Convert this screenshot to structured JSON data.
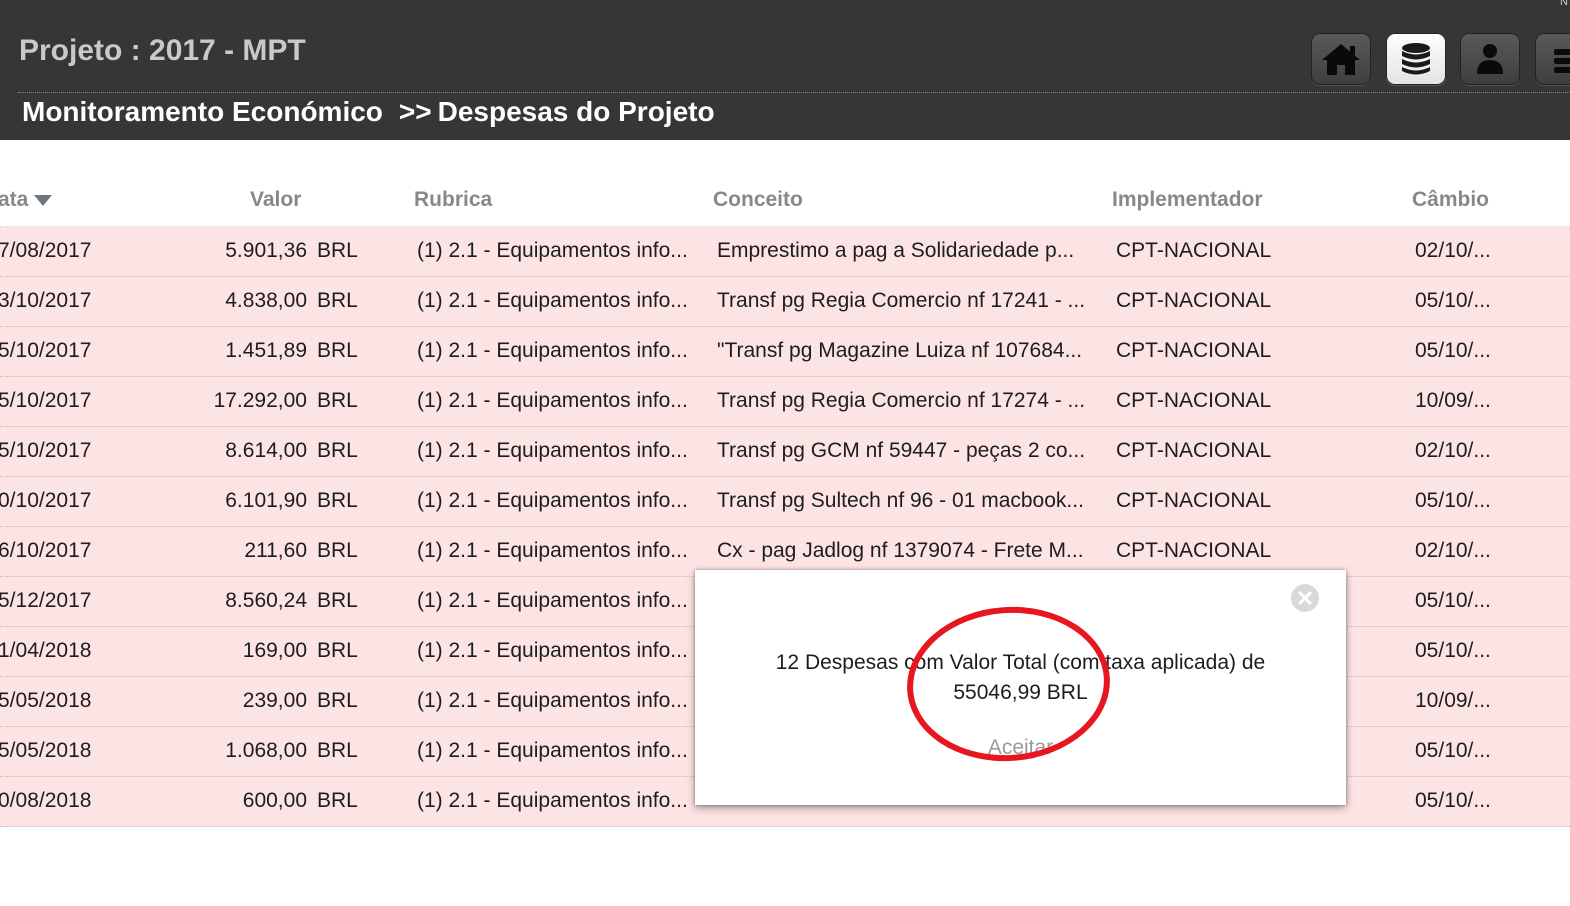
{
  "header": {
    "corner_mark": "N",
    "project_title": "Projeto : 2017 - MPT",
    "breadcrumb": {
      "section": "Monitoramento Económico",
      "separator": ">>",
      "page": "Despesas do Projeto"
    },
    "nav_icons": [
      "home-icon",
      "database-icon",
      "user-icon",
      "list-icon"
    ]
  },
  "table": {
    "headers": {
      "data": "ata",
      "valor": "Valor",
      "rubrica": "Rubrica",
      "conceito": "Conceito",
      "implementador": "Implementador",
      "cambio": "Câmbio"
    },
    "rows": [
      {
        "data": "7/08/2017",
        "valor": "5.901,36",
        "moeda": "BRL",
        "rubrica": "(1) 2.1 - Equipamentos info...",
        "conceito": "Emprestimo a pag a Solidariedade p...",
        "implementador": "CPT-NACIONAL",
        "cambio": "02/10/..."
      },
      {
        "data": "3/10/2017",
        "valor": "4.838,00",
        "moeda": "BRL",
        "rubrica": "(1) 2.1 - Equipamentos info...",
        "conceito": "Transf pg Regia Comercio nf 17241 - ...",
        "implementador": "CPT-NACIONAL",
        "cambio": "05/10/..."
      },
      {
        "data": "5/10/2017",
        "valor": "1.451,89",
        "moeda": "BRL",
        "rubrica": "(1) 2.1 - Equipamentos info...",
        "conceito": "\"Transf pg Magazine Luiza nf 107684...",
        "implementador": "CPT-NACIONAL",
        "cambio": "05/10/..."
      },
      {
        "data": "5/10/2017",
        "valor": "17.292,00",
        "moeda": "BRL",
        "rubrica": "(1) 2.1 - Equipamentos info...",
        "conceito": "Transf pg Regia Comercio nf 17274 - ...",
        "implementador": "CPT-NACIONAL",
        "cambio": "10/09/..."
      },
      {
        "data": "5/10/2017",
        "valor": "8.614,00",
        "moeda": "BRL",
        "rubrica": "(1) 2.1 - Equipamentos info...",
        "conceito": "Transf pg GCM nf 59447 - peças 2 co...",
        "implementador": "CPT-NACIONAL",
        "cambio": "02/10/..."
      },
      {
        "data": "0/10/2017",
        "valor": "6.101,90",
        "moeda": "BRL",
        "rubrica": "(1) 2.1 - Equipamentos info...",
        "conceito": "Transf pg Sultech nf 96 - 01 macbook...",
        "implementador": "CPT-NACIONAL",
        "cambio": "05/10/..."
      },
      {
        "data": "6/10/2017",
        "valor": "211,60",
        "moeda": "BRL",
        "rubrica": "(1) 2.1 - Equipamentos info...",
        "conceito": "Cx - pag Jadlog nf 1379074 - Frete M...",
        "implementador": "CPT-NACIONAL",
        "cambio": "02/10/..."
      },
      {
        "data": "5/12/2017",
        "valor": "8.560,24",
        "moeda": "BRL",
        "rubrica": "(1) 2.1 - Equipamentos info...",
        "conceito": "",
        "implementador": "",
        "cambio": "05/10/..."
      },
      {
        "data": "1/04/2018",
        "valor": "169,00",
        "moeda": "BRL",
        "rubrica": "(1) 2.1 - Equipamentos info...",
        "conceito": "",
        "implementador": "",
        "cambio": "05/10/..."
      },
      {
        "data": "5/05/2018",
        "valor": "239,00",
        "moeda": "BRL",
        "rubrica": "(1) 2.1 - Equipamentos info...",
        "conceito": "",
        "implementador": "",
        "cambio": "10/09/..."
      },
      {
        "data": "5/05/2018",
        "valor": "1.068,00",
        "moeda": "BRL",
        "rubrica": "(1) 2.1 - Equipamentos info...",
        "conceito": "",
        "implementador": "",
        "cambio": "05/10/..."
      },
      {
        "data": "0/08/2018",
        "valor": "600,00",
        "moeda": "BRL",
        "rubrica": "(1) 2.1 - Equipamentos info...",
        "conceito": "",
        "implementador": "",
        "cambio": "05/10/..."
      }
    ]
  },
  "modal": {
    "message_line1": "12 Despesas com Valor Total (com taxa aplicada) de",
    "message_line2": "55046,99 BRL",
    "accept_label": "Aceitar",
    "close_icon": "close-circle-icon"
  },
  "annotation": {
    "ring_color": "#e8161e"
  },
  "colors": {
    "header_bg": "#363636",
    "row_bg": "#fde4e4",
    "header_text": "#c9c9c9"
  }
}
